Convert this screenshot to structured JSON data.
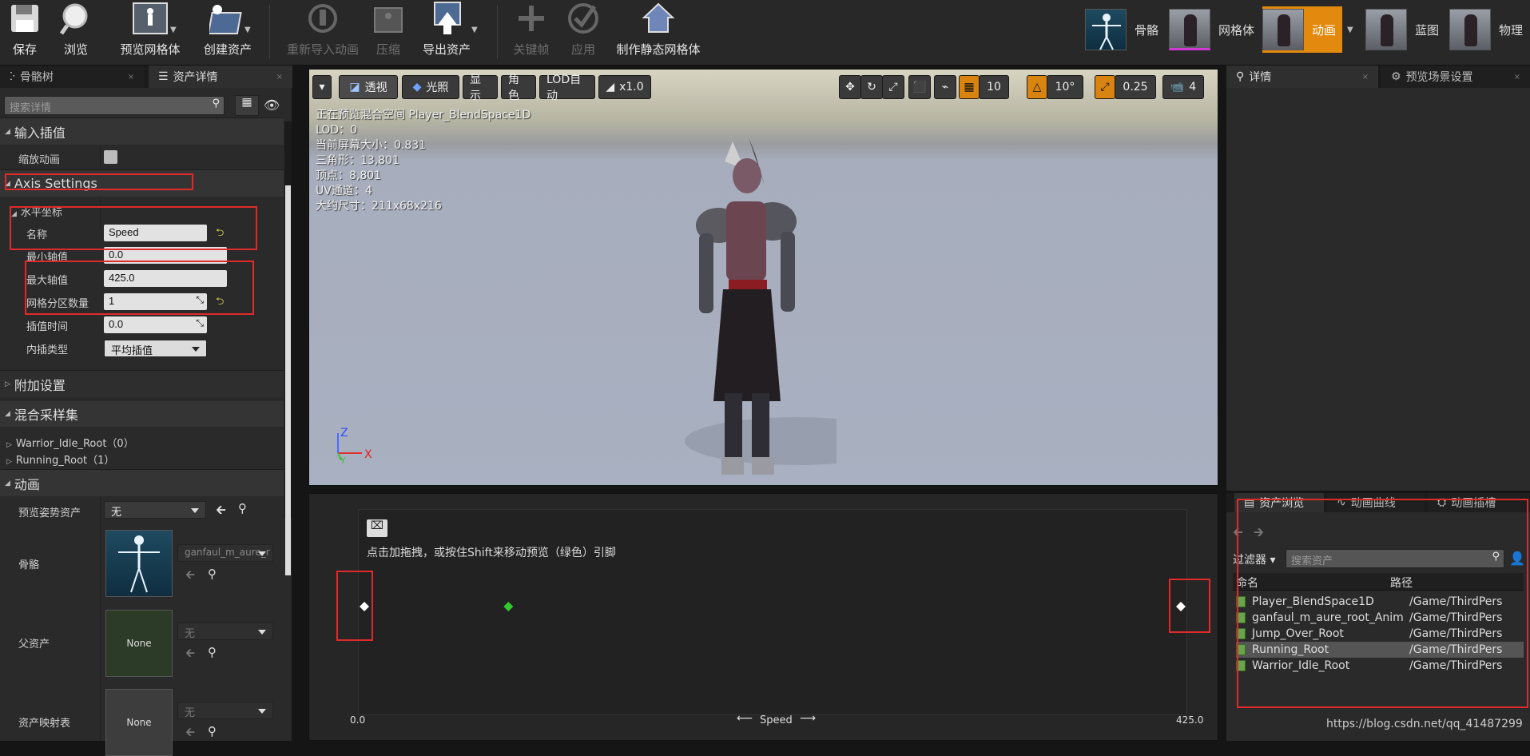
{
  "toolbar": {
    "save": "保存",
    "browse": "浏览",
    "preview_mesh": "预览网格体",
    "create_asset": "创建资产",
    "reimport": "重新导入动画",
    "compress": "压缩",
    "export": "导出资产",
    "keyframe": "关键帧",
    "apply": "应用",
    "make_static": "制作静态网格体"
  },
  "modes": {
    "skeleton": "骨骼",
    "mesh": "网格体",
    "animation": "动画",
    "blueprint": "蓝图",
    "physics": "物理"
  },
  "left_tabs": {
    "skeleton_tree": "骨骼树",
    "asset_details": "资产详情"
  },
  "left": {
    "search_placeholder": "搜索详情",
    "input_interp": "输入插值",
    "scale_anim": "缩放动画",
    "axis_settings": "Axis Settings",
    "horizontal_axis": "水平坐标",
    "name_label": "名称",
    "name_value": "Speed",
    "min_label": "最小轴值",
    "min_value": "0.0",
    "max_label": "最大轴值",
    "max_value": "425.0",
    "grid_label": "网格分区数量",
    "grid_value": "1",
    "interp_time_label": "插值时间",
    "interp_time_value": "0.0",
    "interp_type_label": "内插类型",
    "interp_type_value": "平均插值",
    "additional": "附加设置",
    "samples": "混合采样集",
    "sample0": "Warrior_Idle_Root（0）",
    "sample1": "Running_Root（1）",
    "animation": "动画",
    "preview_pose_label": "预览姿势资产",
    "preview_pose_value": "无",
    "skeleton_label": "骨骼",
    "skeleton_value": "ganfaul_m_aure_r",
    "parent_label": "父资产",
    "parent_thumb": "None",
    "parent_value": "无",
    "mapping_label": "资产映射表",
    "mapping_thumb": "None",
    "mapping_value": "无"
  },
  "viewport": {
    "perspective": "透视",
    "lit": "光照",
    "show": "显示",
    "character": "角色",
    "lod": "LOD自动",
    "speed": "x1.0",
    "grid_snap": "10",
    "rot_snap": "10°",
    "scale_snap": "0.25",
    "cam_speed": "4",
    "stats": [
      "正在预览混合空间 Player_BlendSpace1D",
      "LOD：0",
      "当前屏幕大小：0.831",
      "三角形：13,801",
      "顶点：8,801",
      "UV通道：4",
      "大约尺寸：211x68x216"
    ],
    "axis_z": "Z",
    "axis_x": "X",
    "axis_y": "Y"
  },
  "right_tabs": {
    "details": "详情",
    "preview_scene": "预览场景设置"
  },
  "blend": {
    "hint": "点击加拖拽，或按住Shift来移动预览（绿色）引脚",
    "min": "0.0",
    "max": "425.0",
    "axis_name": "Speed",
    "arrow_left": "⟵",
    "arrow_right": "⟶",
    "samples": [
      0,
      425
    ],
    "preview_value": 75
  },
  "assets": {
    "tab_browser": "资产浏览",
    "tab_curves": "动画曲线",
    "tab_slots": "动画插槽",
    "filter": "过滤器",
    "search_placeholder": "搜索资产",
    "col_name": "命名",
    "col_path": "路径",
    "rows": [
      {
        "name": "Player_BlendSpace1D",
        "path": "/Game/ThirdPers"
      },
      {
        "name": "ganfaul_m_aure_root_Anim",
        "path": "/Game/ThirdPers"
      },
      {
        "name": "Jump_Over_Root",
        "path": "/Game/ThirdPers"
      },
      {
        "name": "Running_Root",
        "path": "/Game/ThirdPers"
      },
      {
        "name": "Warrior_Idle_Root",
        "path": "/Game/ThirdPers"
      }
    ]
  },
  "watermark": "https://blog.csdn.net/qq_41487299"
}
